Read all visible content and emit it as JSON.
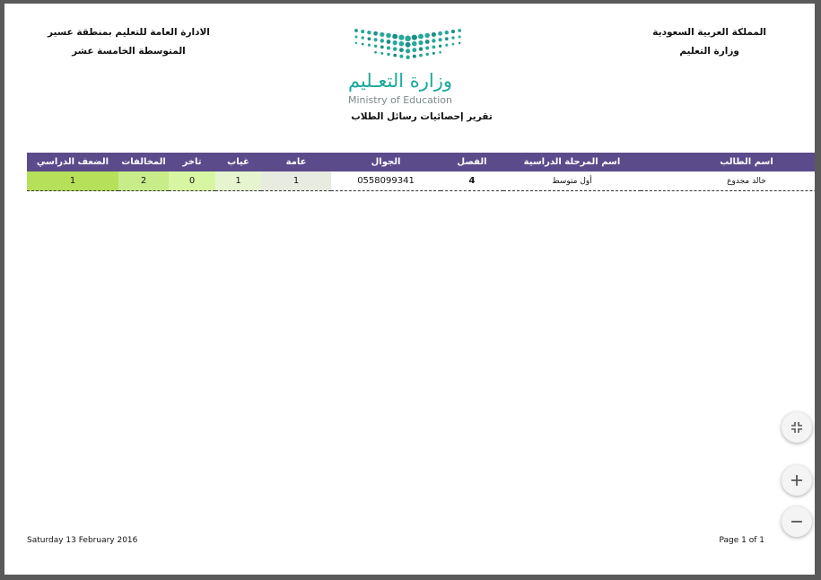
{
  "header": {
    "right_line1": "المملكة العربية السعودية",
    "right_line2": "وزارة التعليم",
    "left_line1": "الادارة العامة للتعليم بمنطقة عسير",
    "left_line2": "المتوسطة الخامسة عشر",
    "logo_arabic": "وزارة التعـليم",
    "logo_english": "Ministry of Education",
    "report_title": "تقرير إحصائيات رسائل الطلاب"
  },
  "table": {
    "columns": [
      "اسم الطالب",
      "اسم المرحلة الدراسية",
      "الفصل",
      "الجوال",
      "عامة",
      "غياب",
      "تاخر",
      "المخالفات",
      "الضعف الدراسي"
    ],
    "rows": [
      {
        "name": "خالد مجدوع",
        "stage": "أول متوسط",
        "class": "4",
        "mobile": "0558099341",
        "general": "1",
        "absence": "1",
        "late": "0",
        "violations": "2",
        "weakness": "1"
      }
    ]
  },
  "colors": {
    "header_bg": "#5b4b8b",
    "general_bg": "#e8ebe0",
    "absence_bg": "#e6f5cf",
    "late_bg": "#d8f5a2",
    "violations_bg": "#c8ec8a",
    "weakness_bg": "#b6e05a"
  },
  "footer": {
    "date": "Saturday 13 February 2016",
    "page": "Page 1 of 1"
  },
  "controls": {
    "fit_icon": "fit-page-icon",
    "zoom_in_icon": "plus-icon",
    "zoom_out_icon": "minus-icon"
  }
}
